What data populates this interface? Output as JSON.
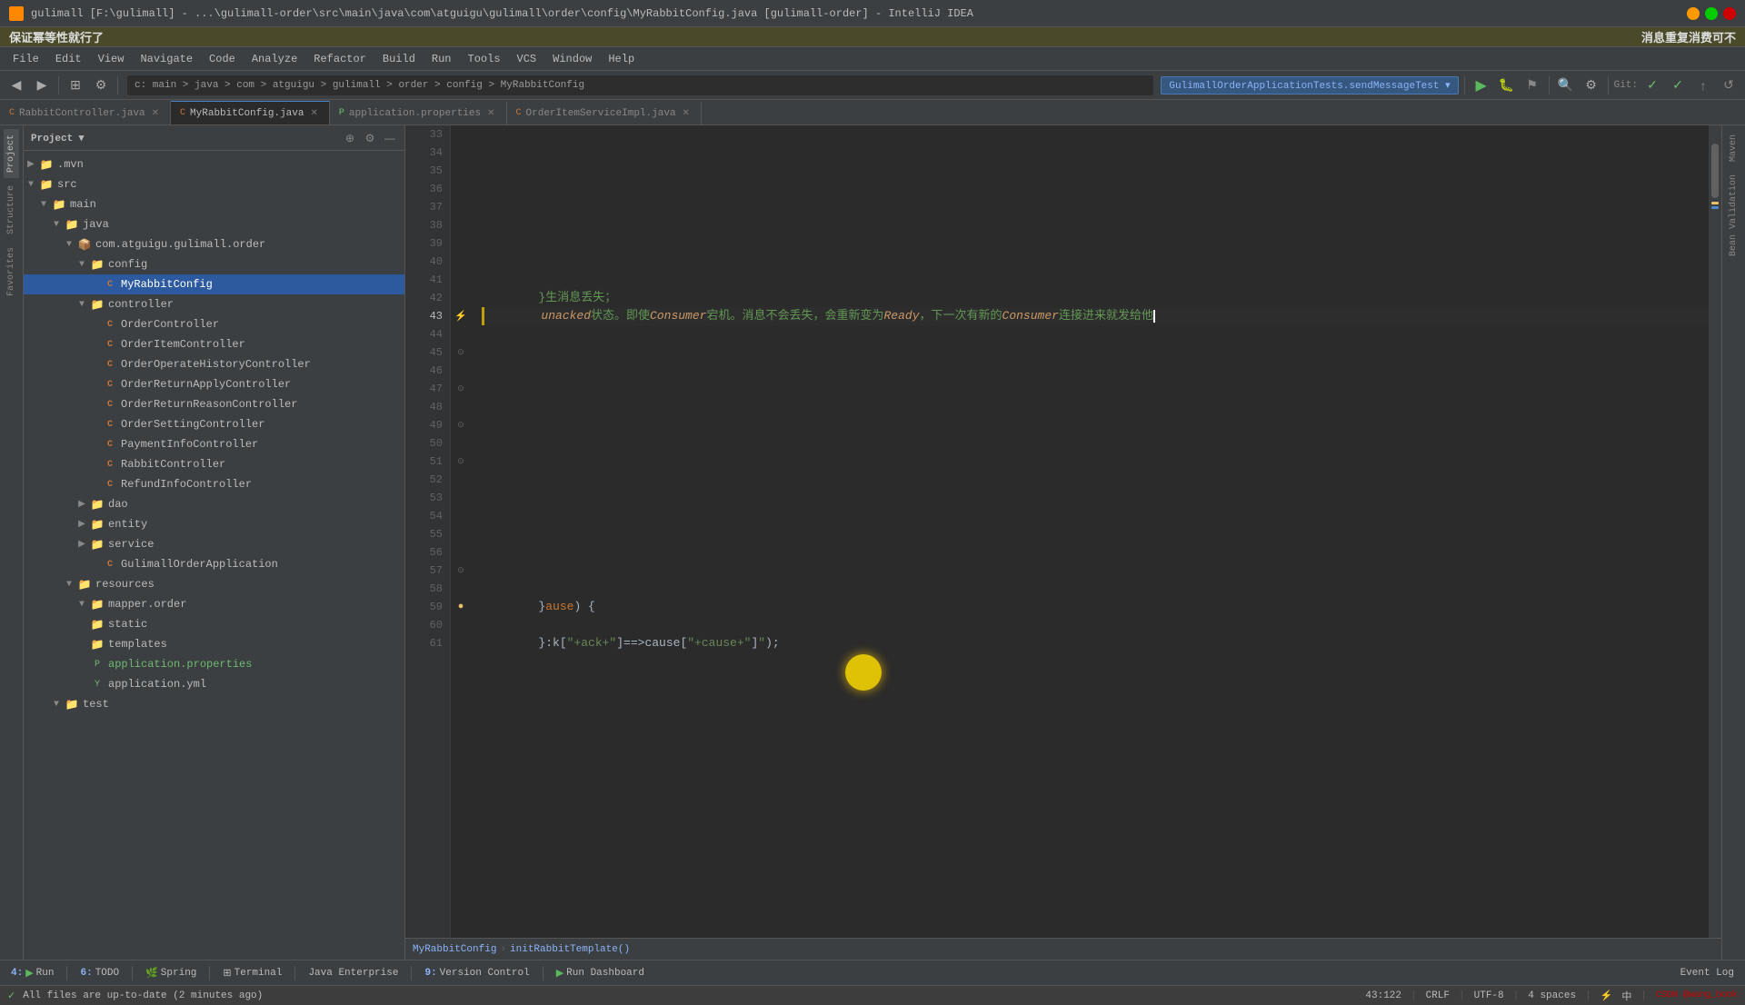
{
  "titleBar": {
    "title": "gulimall [F:\\gulimall] - ...\\gulimall-order\\src\\main\\java\\com\\atguigu\\gulimall\\order\\config\\MyRabbitConfig.java [gulimall-order] - IntelliJ IDEA",
    "appIcon": "intellij-icon"
  },
  "notificationBars": [
    {
      "id": "top-notification",
      "text": "保证幂等性就行了",
      "align": "left"
    },
    {
      "id": "right-notification",
      "text": "消息重复消费可不",
      "align": "right"
    }
  ],
  "menuBar": {
    "items": [
      "File",
      "Edit",
      "View",
      "Navigate",
      "Code",
      "Analyze",
      "Refactor",
      "Build",
      "Run",
      "Tools",
      "VCS",
      "Window",
      "Help"
    ]
  },
  "toolbar": {
    "breadcrumb": "GulimallOrderApplicationTests.sendMessageTest",
    "pathItems": [
      "main",
      "java",
      "com",
      "atguigu",
      "gulimall",
      "order",
      "config",
      "MyRabbitConfig"
    ],
    "gitLabel": "Git:"
  },
  "tabs": [
    {
      "label": "RabbitController.java",
      "type": "java",
      "active": false
    },
    {
      "label": "MyRabbitConfig.java",
      "type": "java",
      "active": true
    },
    {
      "label": "application.properties",
      "type": "prop",
      "active": false
    },
    {
      "label": "OrderItemServiceImpl.java",
      "type": "java",
      "active": false
    }
  ],
  "fileTree": {
    "panelTitle": "Project",
    "items": [
      {
        "level": 0,
        "indent": 0,
        "hasArrow": true,
        "expanded": true,
        "icon": "folder",
        "name": ".mvn"
      },
      {
        "level": 0,
        "indent": 0,
        "hasArrow": true,
        "expanded": true,
        "icon": "folder",
        "name": "src"
      },
      {
        "level": 1,
        "indent": 12,
        "hasArrow": true,
        "expanded": true,
        "icon": "folder",
        "name": "main"
      },
      {
        "level": 2,
        "indent": 24,
        "hasArrow": true,
        "expanded": true,
        "icon": "folder",
        "name": "java"
      },
      {
        "level": 3,
        "indent": 36,
        "hasArrow": true,
        "expanded": true,
        "icon": "folder",
        "name": "com.atguigu.gulimall.order"
      },
      {
        "level": 4,
        "indent": 48,
        "hasArrow": true,
        "expanded": true,
        "icon": "folder",
        "name": "config"
      },
      {
        "level": 5,
        "indent": 60,
        "hasArrow": false,
        "expanded": false,
        "icon": "java-c",
        "name": "MyRabbitConfig",
        "selected": true
      },
      {
        "level": 4,
        "indent": 48,
        "hasArrow": true,
        "expanded": true,
        "icon": "folder",
        "name": "controller"
      },
      {
        "level": 5,
        "indent": 60,
        "hasArrow": false,
        "expanded": false,
        "icon": "java-c",
        "name": "OrderController"
      },
      {
        "level": 5,
        "indent": 60,
        "hasArrow": false,
        "expanded": false,
        "icon": "java-c",
        "name": "OrderItemController"
      },
      {
        "level": 5,
        "indent": 60,
        "hasArrow": false,
        "expanded": false,
        "icon": "java-c",
        "name": "OrderOperateHistoryController"
      },
      {
        "level": 5,
        "indent": 60,
        "hasArrow": false,
        "expanded": false,
        "icon": "java-c",
        "name": "OrderReturnApplyController"
      },
      {
        "level": 5,
        "indent": 60,
        "hasArrow": false,
        "expanded": false,
        "icon": "java-c",
        "name": "OrderReturnReasonController"
      },
      {
        "level": 5,
        "indent": 60,
        "hasArrow": false,
        "expanded": false,
        "icon": "java-c",
        "name": "OrderSettingController"
      },
      {
        "level": 5,
        "indent": 60,
        "hasArrow": false,
        "expanded": false,
        "icon": "java-c",
        "name": "PaymentInfoController"
      },
      {
        "level": 5,
        "indent": 60,
        "hasArrow": false,
        "expanded": false,
        "icon": "java-c",
        "name": "RabbitController"
      },
      {
        "level": 5,
        "indent": 60,
        "hasArrow": false,
        "expanded": false,
        "icon": "java-c",
        "name": "RefundInfoController"
      },
      {
        "level": 4,
        "indent": 48,
        "hasArrow": true,
        "expanded": false,
        "icon": "folder",
        "name": "dao"
      },
      {
        "level": 4,
        "indent": 48,
        "hasArrow": true,
        "expanded": false,
        "icon": "folder",
        "name": "entity"
      },
      {
        "level": 4,
        "indent": 48,
        "hasArrow": true,
        "expanded": false,
        "icon": "folder",
        "name": "service"
      },
      {
        "level": 5,
        "indent": 60,
        "hasArrow": false,
        "expanded": false,
        "icon": "java-c",
        "name": "GulimallOrderApplication"
      },
      {
        "level": 3,
        "indent": 36,
        "hasArrow": true,
        "expanded": true,
        "icon": "folder",
        "name": "resources"
      },
      {
        "level": 4,
        "indent": 48,
        "hasArrow": true,
        "expanded": true,
        "icon": "folder",
        "name": "mapper.order"
      },
      {
        "level": 4,
        "indent": 48,
        "hasArrow": false,
        "expanded": false,
        "icon": "folder",
        "name": "static"
      },
      {
        "level": 4,
        "indent": 48,
        "hasArrow": false,
        "expanded": false,
        "icon": "folder",
        "name": "templates"
      },
      {
        "level": 4,
        "indent": 48,
        "hasArrow": false,
        "expanded": false,
        "icon": "prop",
        "name": "application.properties",
        "highlighted": true
      },
      {
        "level": 4,
        "indent": 48,
        "hasArrow": false,
        "expanded": false,
        "icon": "yaml",
        "name": "application.yml"
      },
      {
        "level": 2,
        "indent": 24,
        "hasArrow": true,
        "expanded": false,
        "icon": "folder",
        "name": "test"
      }
    ]
  },
  "codeEditor": {
    "fileName": "MyRabbitConfig.java",
    "lines": [
      {
        "num": 33,
        "content": "",
        "type": "empty"
      },
      {
        "num": 34,
        "content": "",
        "type": "empty"
      },
      {
        "num": 35,
        "content": "",
        "type": "empty"
      },
      {
        "num": 36,
        "content": "",
        "type": "empty"
      },
      {
        "num": 37,
        "content": "",
        "type": "empty"
      },
      {
        "num": 38,
        "content": "",
        "type": "empty"
      },
      {
        "num": 39,
        "content": "",
        "type": "empty"
      },
      {
        "num": 40,
        "content": "",
        "type": "empty"
      },
      {
        "num": 41,
        "content": "",
        "type": "empty"
      },
      {
        "num": 42,
        "content": "        }生消息丢失；",
        "type": "comment-chinese",
        "hasFold": false
      },
      {
        "num": 43,
        "content": "        ⚡=unacked状态。即使Consumer宕机。消息不会丢失，会重新变为Ready，下一次有新的Consumer连接进来就发给他",
        "type": "comment-chinese",
        "hasFold": false,
        "hasGutter": true,
        "active": true
      },
      {
        "num": 44,
        "content": "",
        "type": "empty"
      },
      {
        "num": 45,
        "content": "",
        "type": "empty",
        "hasFold": true
      },
      {
        "num": 46,
        "content": "",
        "type": "empty"
      },
      {
        "num": 47,
        "content": "",
        "type": "empty",
        "hasFold": true
      },
      {
        "num": 48,
        "content": "",
        "type": "empty"
      },
      {
        "num": 49,
        "content": "",
        "type": "empty",
        "hasFold": true
      },
      {
        "num": 50,
        "content": "",
        "type": "empty"
      },
      {
        "num": 51,
        "content": "",
        "type": "empty",
        "hasFold": true
      },
      {
        "num": 52,
        "content": "",
        "type": "empty"
      },
      {
        "num": 53,
        "content": "",
        "type": "empty"
      },
      {
        "num": 54,
        "content": "",
        "type": "empty"
      },
      {
        "num": 55,
        "content": "",
        "type": "empty"
      },
      {
        "num": 56,
        "content": "",
        "type": "empty"
      },
      {
        "num": 57,
        "content": "",
        "type": "empty",
        "hasFold": true
      },
      {
        "num": 58,
        "content": "",
        "type": "empty"
      },
      {
        "num": 59,
        "content": "        }ause) {",
        "type": "code",
        "hasGutter": true
      },
      {
        "num": 60,
        "content": "",
        "type": "empty"
      },
      {
        "num": 61,
        "content": "        }:k[\"+ack+\"]==>cause[\"+cause+\"]\");",
        "type": "code"
      }
    ],
    "bottomNav": {
      "items": [
        "MyRabbitConfig",
        "initRabbitTemplate()"
      ]
    }
  },
  "leftVTabs": [
    "1: Project",
    "2: Favorites"
  ],
  "rightVTabs": [
    "Maven",
    "Bean Validation"
  ],
  "bottomToolbar": {
    "items": [
      {
        "num": "4",
        "label": "Run"
      },
      {
        "num": "6",
        "label": "TODO"
      },
      {
        "label": "Spring",
        "icon": "spring"
      },
      {
        "label": "Terminal"
      },
      {
        "label": "Java Enterprise"
      },
      {
        "num": "9",
        "label": "Version Control"
      },
      {
        "label": "Run Dashboard",
        "icon": "run"
      },
      {
        "label": "Event Log",
        "align": "right"
      }
    ]
  },
  "statusBar": {
    "message": "All files are up-to-date (2 minutes ago)",
    "position": "43:122",
    "lineEnding": "CRLF",
    "encoding": "UTF-8",
    "indent": "4 spaces",
    "layout": "中",
    "csdn": "CSDN @wang_book"
  }
}
